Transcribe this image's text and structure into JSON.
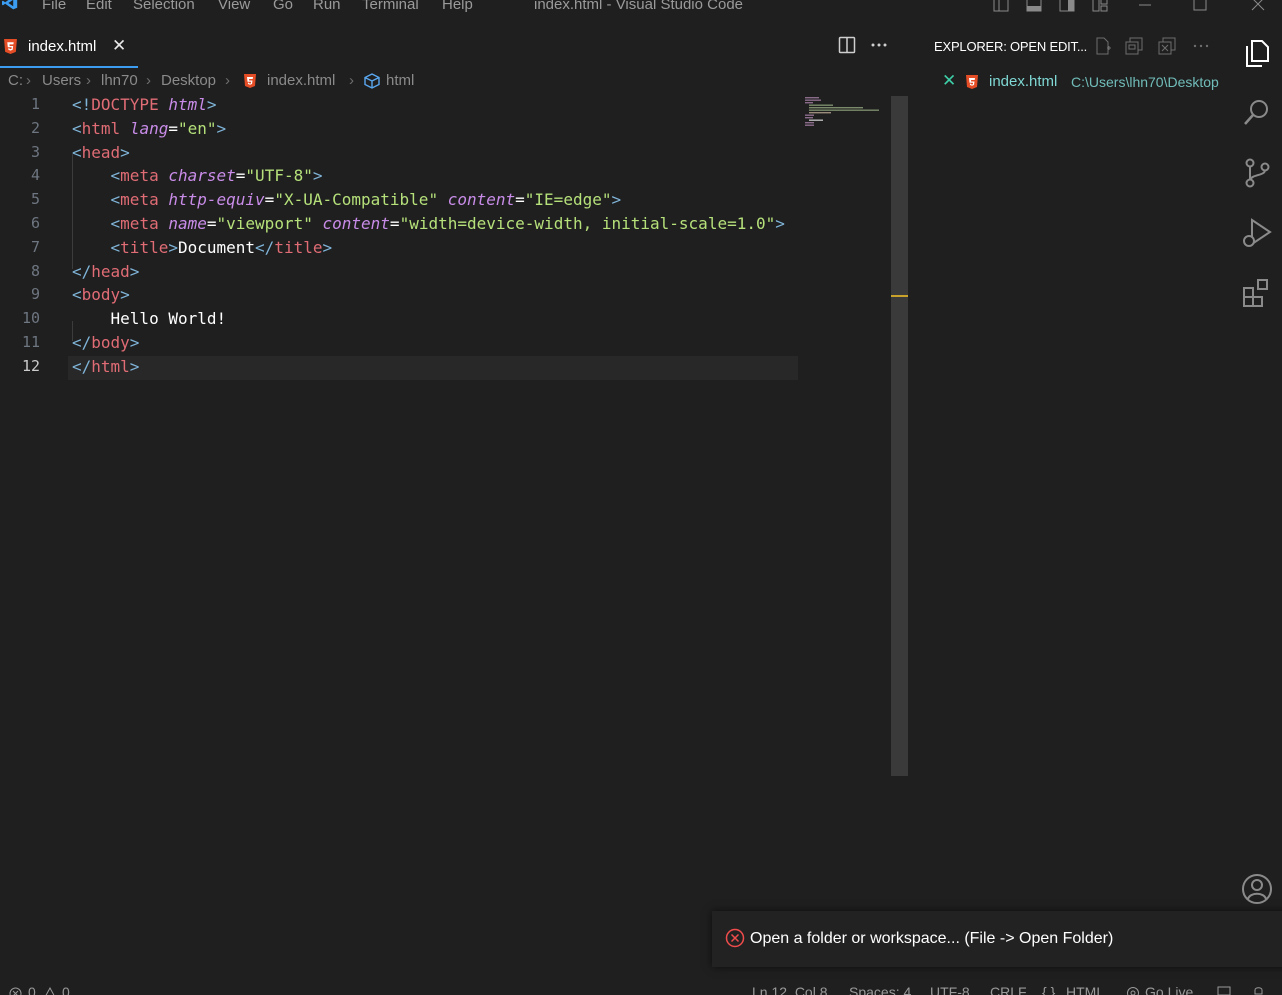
{
  "window": {
    "title": "index.html - Visual Studio Code",
    "menu": [
      "File",
      "Edit",
      "Selection",
      "View",
      "Go",
      "Run",
      "Terminal",
      "Help"
    ]
  },
  "tab": {
    "label": "index.html",
    "close": "✕"
  },
  "breadcrumb": {
    "parts": [
      "C:",
      "Users",
      "lhn70",
      "Desktop",
      "index.html",
      "html"
    ]
  },
  "editor": {
    "line_numbers": [
      "1",
      "2",
      "3",
      "4",
      "5",
      "6",
      "7",
      "8",
      "9",
      "10",
      "11",
      "12"
    ],
    "lines": [
      [
        [
          "br",
          "<!"
        ],
        [
          "tag",
          "DOCTYPE "
        ],
        [
          "attr",
          "html"
        ],
        [
          "br",
          ">"
        ]
      ],
      [
        [
          "br",
          "<"
        ],
        [
          "tag",
          "html "
        ],
        [
          "attr",
          "lang"
        ],
        [
          "txt",
          "="
        ],
        [
          "str",
          "\"en\""
        ],
        [
          "br",
          ">"
        ]
      ],
      [
        [
          "br",
          "<"
        ],
        [
          "tag",
          "head"
        ],
        [
          "br",
          ">"
        ]
      ],
      [
        [
          "txt",
          "    "
        ],
        [
          "br",
          "<"
        ],
        [
          "tag",
          "meta "
        ],
        [
          "attr",
          "charset"
        ],
        [
          "txt",
          "="
        ],
        [
          "str",
          "\"UTF-8\""
        ],
        [
          "br",
          ">"
        ]
      ],
      [
        [
          "txt",
          "    "
        ],
        [
          "br",
          "<"
        ],
        [
          "tag",
          "meta "
        ],
        [
          "attr",
          "http-equiv"
        ],
        [
          "txt",
          "="
        ],
        [
          "str",
          "\"X-UA-Compatible\" "
        ],
        [
          "attr",
          "content"
        ],
        [
          "txt",
          "="
        ],
        [
          "str",
          "\"IE=edge\""
        ],
        [
          "br",
          ">"
        ]
      ],
      [
        [
          "txt",
          "    "
        ],
        [
          "br",
          "<"
        ],
        [
          "tag",
          "meta "
        ],
        [
          "attr",
          "name"
        ],
        [
          "txt",
          "="
        ],
        [
          "str",
          "\"viewport\" "
        ],
        [
          "attr",
          "content"
        ],
        [
          "txt",
          "="
        ],
        [
          "str",
          "\"width=device-width, initial-scale=1.0\""
        ],
        [
          "br",
          ">"
        ]
      ],
      [
        [
          "txt",
          "    "
        ],
        [
          "br",
          "<"
        ],
        [
          "tag",
          "title"
        ],
        [
          "br",
          ">"
        ],
        [
          "txt",
          "Document"
        ],
        [
          "br",
          "</"
        ],
        [
          "tag",
          "title"
        ],
        [
          "br",
          ">"
        ]
      ],
      [
        [
          "br",
          "</"
        ],
        [
          "tag",
          "head"
        ],
        [
          "br",
          ">"
        ]
      ],
      [
        [
          "br",
          "<"
        ],
        [
          "tag",
          "body"
        ],
        [
          "br",
          ">"
        ]
      ],
      [
        [
          "txt",
          "    Hello World!"
        ]
      ],
      [
        [
          "br",
          "</"
        ],
        [
          "tag",
          "body"
        ],
        [
          "br",
          ">"
        ]
      ],
      [
        [
          "br",
          "</"
        ],
        [
          "tag",
          "html"
        ],
        [
          "br",
          ">"
        ]
      ]
    ]
  },
  "explorer": {
    "title": "EXPLORER: OPEN EDIT...",
    "open_editor": {
      "name": "index.html",
      "path": "C:\\Users\\lhn70\\Desktop",
      "close": "✕"
    }
  },
  "notification": {
    "message": "Open a folder or workspace... (File -> Open Folder)"
  },
  "status": {
    "errors": "0",
    "warnings": "0",
    "position": "Ln 12, Col 8",
    "spaces": "Spaces: 4",
    "encoding": "UTF-8",
    "eol": "CRLF",
    "language": "HTML",
    "golive": "Go Live"
  },
  "colors": {
    "accent": "#3b9cf0",
    "html5": "#e44d26",
    "error": "#f14c4c"
  }
}
